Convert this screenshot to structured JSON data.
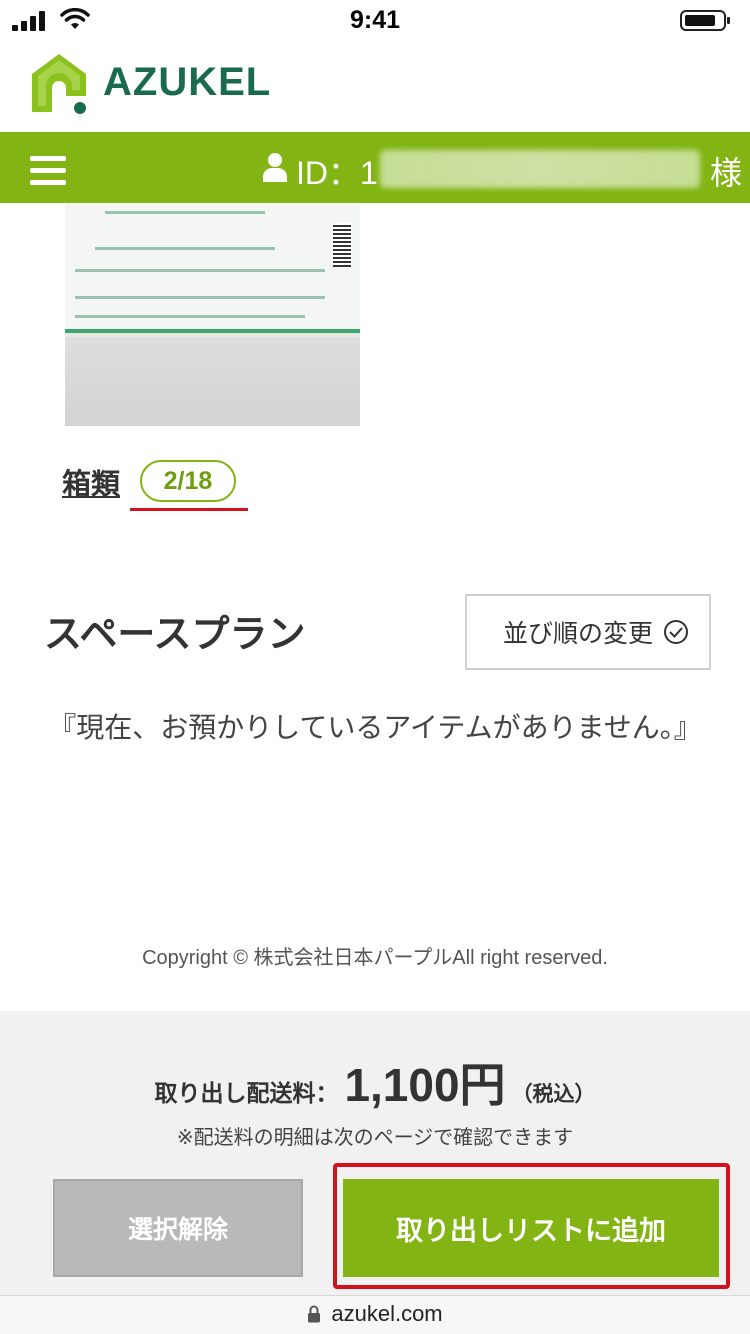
{
  "status_bar": {
    "time": "9:41"
  },
  "header": {
    "logo_text": "AZUKEL"
  },
  "nav": {
    "id_label": "ID：1",
    "honorific": "様"
  },
  "box": {
    "label": "箱類",
    "count": "2/18"
  },
  "plan": {
    "title": "スペースプラン",
    "sort_label": "並び順の変更",
    "empty_message": "『現在、お預かりしているアイテムがありません。』"
  },
  "copyright": "Copyright © 株式会社日本パープルAll right reserved.",
  "footer": {
    "fee_label": "取り出し配送料：",
    "fee_amount": "1,100円",
    "fee_tax": "（税込）",
    "fee_note": "※配送料の明細は次のページで確認できます",
    "deselect_label": "選択解除",
    "add_label": "取り出しリストに追加"
  },
  "url_bar": {
    "domain": "azukel.com"
  },
  "colors": {
    "brand_green": "#82b414",
    "logo_green": "#1a6b4d",
    "highlight_red": "#d4121e"
  },
  "icons": [
    "menu-icon",
    "user-icon",
    "clock-icon",
    "lock-icon"
  ]
}
